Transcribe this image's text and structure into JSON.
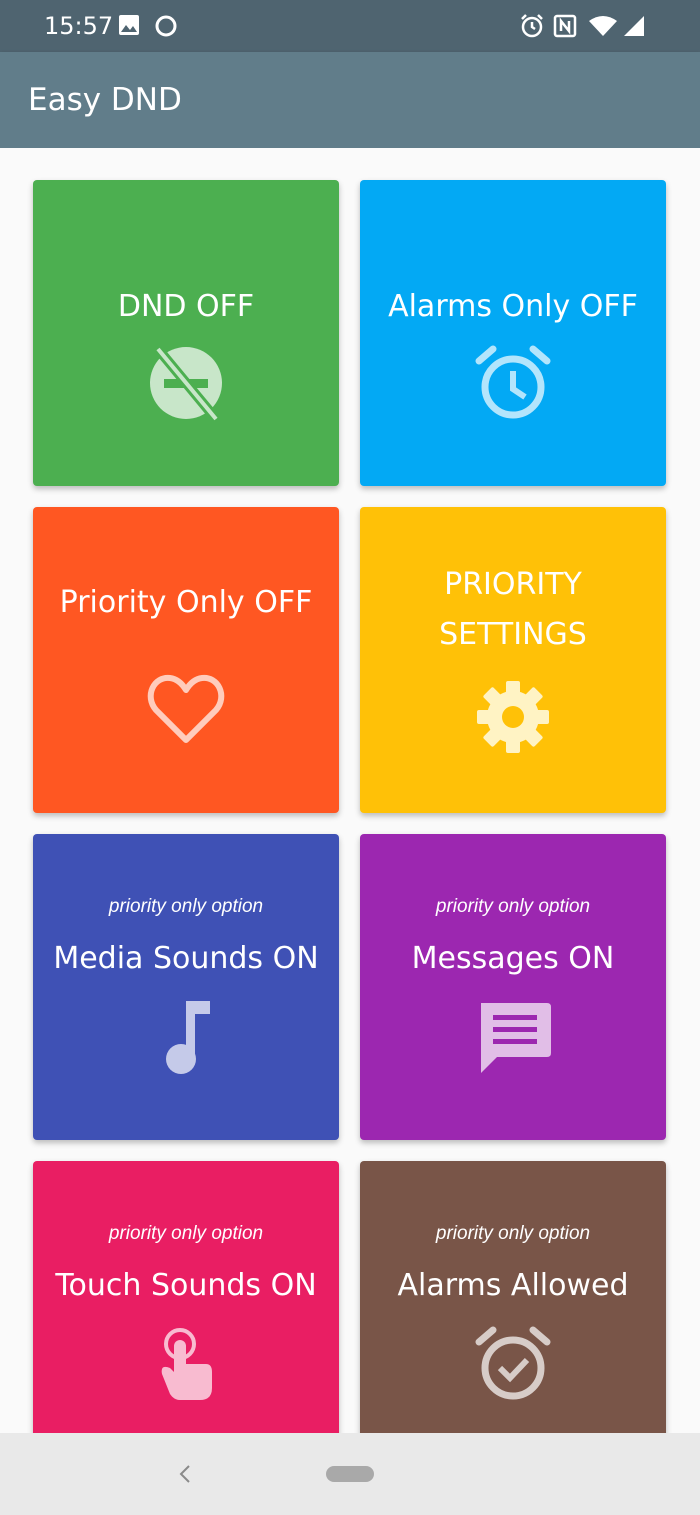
{
  "status_bar": {
    "time": "15:57",
    "left_icons": [
      "image-icon",
      "sync-circle-icon"
    ],
    "right_icons": [
      "alarm-icon",
      "nfc-icon",
      "wifi-icon",
      "signal-icon"
    ]
  },
  "app_bar": {
    "title": "Easy DND"
  },
  "tiles": [
    {
      "label": "DND OFF",
      "subtitle": "",
      "color": "#4caf50",
      "icon": "dnd-off-icon"
    },
    {
      "label": "Alarms Only OFF",
      "subtitle": "",
      "color": "#03a9f4",
      "icon": "alarm-clock-icon"
    },
    {
      "label": "Priority Only OFF",
      "subtitle": "",
      "color": "#ff5722",
      "icon": "heart-icon"
    },
    {
      "label": "PRIORITY\nSETTINGS",
      "subtitle": "",
      "color": "#ffc107",
      "icon": "gear-icon"
    },
    {
      "label": "Media Sounds ON",
      "subtitle": "priority only option",
      "color": "#3f51b5",
      "icon": "music-note-icon"
    },
    {
      "label": "Messages ON",
      "subtitle": "priority only option",
      "color": "#9c27b0",
      "icon": "message-icon"
    },
    {
      "label": "Touch Sounds ON",
      "subtitle": "priority only option",
      "color": "#e91e63",
      "icon": "touch-icon"
    },
    {
      "label": "Alarms Allowed",
      "subtitle": "priority only option",
      "color": "#795548",
      "icon": "alarm-check-icon"
    }
  ],
  "nav_bar": {
    "icons": [
      "back-icon",
      "home-pill-icon"
    ]
  }
}
